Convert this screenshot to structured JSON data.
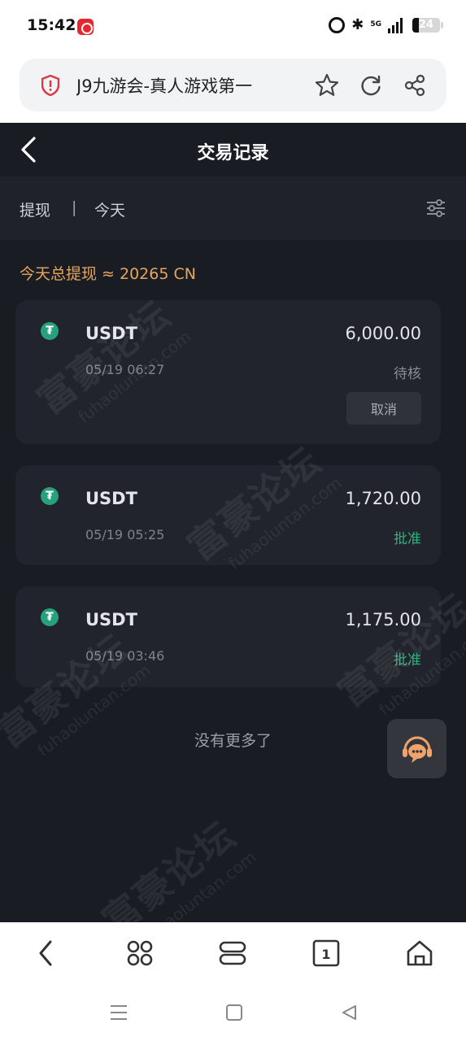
{
  "status_bar": {
    "time": "15:42",
    "network": "5G",
    "battery": "24"
  },
  "browser": {
    "url_title": "J9九游会-真人游戏第一",
    "icons": [
      "shield-icon",
      "star-icon",
      "refresh-icon",
      "share-icon"
    ]
  },
  "header": {
    "title": "交易记录",
    "back_icon": "chevron-left-icon"
  },
  "filter": {
    "type": "提现",
    "separator": "|",
    "date": "今天",
    "filter_icon": "sliders-icon"
  },
  "summary": "今天总提现 ≈ 20265 CN",
  "transactions": [
    {
      "coin": "USDT",
      "amount": "6,000.00",
      "time": "05/19 06:27",
      "status": "待核",
      "action": "取消"
    },
    {
      "coin": "USDT",
      "amount": "1,720.00",
      "time": "05/19 05:25",
      "status": "批准"
    },
    {
      "coin": "USDT",
      "amount": "1,175.00",
      "time": "05/19 03:46",
      "status": "批准"
    }
  ],
  "coin_symbol": "₮",
  "no_more": "没有更多了",
  "watermark": {
    "main": "富豪论坛",
    "sub": "fuhaoluntan.com"
  },
  "bottom_nav": {
    "tabs_count": "1",
    "icons": [
      "back-icon",
      "apps-icon",
      "menu-icon",
      "tabs-icon",
      "home-icon"
    ]
  },
  "colors": {
    "background": "#1a1c24",
    "card": "#22242d",
    "accent_orange": "#e6a65a",
    "approved_green": "#2fb37a",
    "usdt_green": "#26a17b"
  }
}
